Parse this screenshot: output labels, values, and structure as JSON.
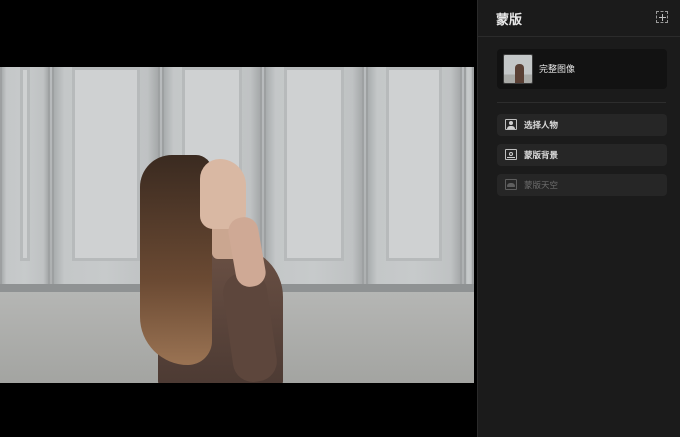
{
  "sidebar": {
    "title": "蒙版",
    "add_icon": "add-mask-icon",
    "full_image": {
      "label": "完整图像"
    },
    "mask_options": [
      {
        "label": "选择人物",
        "icon": "person-icon",
        "enabled": true
      },
      {
        "label": "蒙版背景",
        "icon": "background-icon",
        "enabled": true
      },
      {
        "label": "蒙版天空",
        "icon": "sky-icon",
        "enabled": false
      }
    ]
  },
  "colors": {
    "sidebar_bg": "#1b1b1b",
    "item_bg": "#262626",
    "canvas_bg": "#000000"
  }
}
